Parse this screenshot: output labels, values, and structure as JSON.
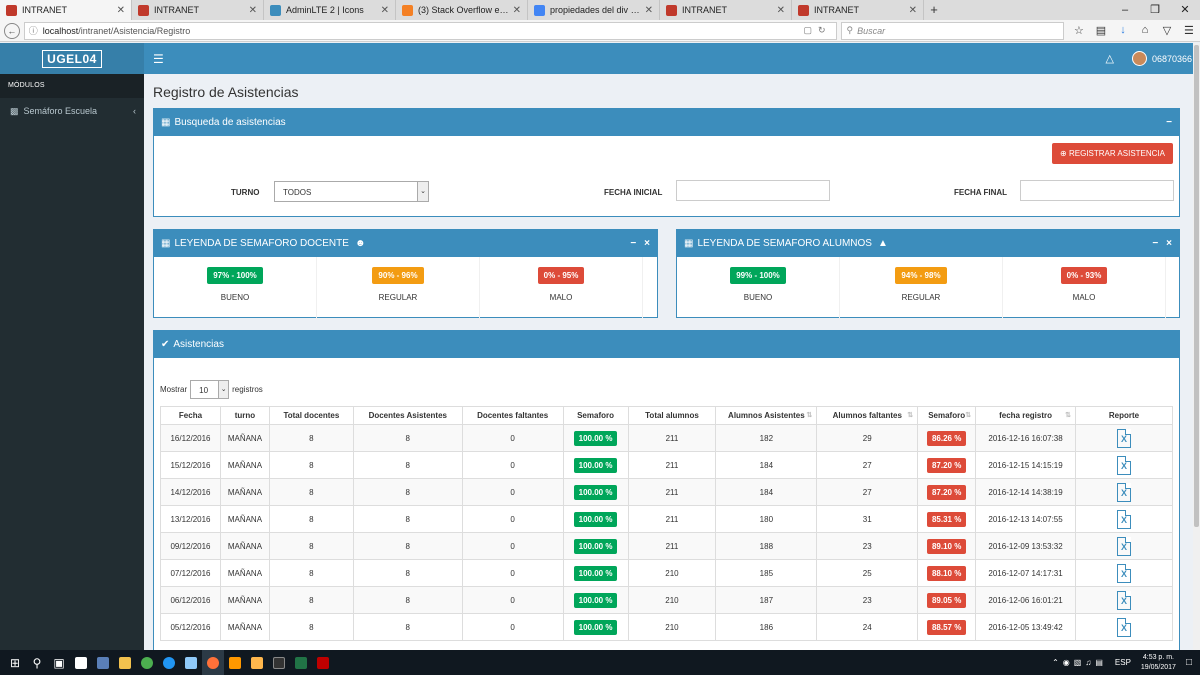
{
  "browser": {
    "tabs": [
      {
        "label": "INTRANET",
        "color": "#c0392b"
      },
      {
        "label": "INTRANET",
        "color": "#c0392b"
      },
      {
        "label": "AdminLTE 2 | Icons",
        "color": "#3c8dbc"
      },
      {
        "label": "(3) Stack Overflow en españ",
        "color": "#f48024"
      },
      {
        "label": "propiedades del div - Buscar",
        "color": "#4285f4"
      },
      {
        "label": "INTRANET",
        "color": "#c0392b"
      },
      {
        "label": "INTRANET",
        "color": "#c0392b"
      }
    ],
    "url_host": "localhost",
    "url_path": "/intranet/Asistencia/Registro",
    "search_placeholder": "Buscar"
  },
  "app": {
    "logo": "UGEL04",
    "username": "06870366",
    "page_title": "Registro de Asistencias"
  },
  "sidebar": {
    "header": "MÓDULOS",
    "items": [
      {
        "label": "Semáforo Escuela"
      }
    ]
  },
  "search_box": {
    "title": "Busqueda de asistencias",
    "register_button": "REGISTRAR ASISTENCIA",
    "turno_label": "TURNO",
    "turno_value": "TODOS",
    "fecha_inicial_label": "FECHA INICIAL",
    "fecha_final_label": "FECHA FINAL"
  },
  "legend_docente": {
    "title": "LEYENDA DE SEMAFORO DOCENTE",
    "items": [
      {
        "range": "97% - 100%",
        "label": "BUENO",
        "color": "#00a65a"
      },
      {
        "range": "90% - 96%",
        "label": "REGULAR",
        "color": "#f39c12"
      },
      {
        "range": "0% - 95%",
        "label": "MALO",
        "color": "#dd4b39"
      }
    ]
  },
  "legend_alumnos": {
    "title": "LEYENDA DE SEMAFORO ALUMNOS",
    "items": [
      {
        "range": "99% - 100%",
        "label": "BUENO",
        "color": "#00a65a"
      },
      {
        "range": "94% - 98%",
        "label": "REGULAR",
        "color": "#f39c12"
      },
      {
        "range": "0% - 93%",
        "label": "MALO",
        "color": "#dd4b39"
      }
    ]
  },
  "asistencias": {
    "title": "Asistencias",
    "show_label": "Mostrar",
    "page_size": "10",
    "records_label": "registros",
    "columns": [
      "Fecha",
      "turno",
      "Total docentes",
      "Docentes Asistentes",
      "Docentes faltantes",
      "Semaforo",
      "Total alumnos",
      "Alumnos Asistentes",
      "Alumnos faltantes",
      "Semaforo",
      "fecha registro",
      "Reporte"
    ],
    "rows": [
      {
        "fecha": "16/12/2016",
        "turno": "MAÑANA",
        "total_doc": "8",
        "doc_asis": "8",
        "doc_falt": "0",
        "sem_doc": "100.00 %",
        "total_alu": "211",
        "alu_asis": "182",
        "alu_falt": "29",
        "sem_alu": "86.26 %",
        "registro": "2016-12-16 16:07:38"
      },
      {
        "fecha": "15/12/2016",
        "turno": "MAÑANA",
        "total_doc": "8",
        "doc_asis": "8",
        "doc_falt": "0",
        "sem_doc": "100.00 %",
        "total_alu": "211",
        "alu_asis": "184",
        "alu_falt": "27",
        "sem_alu": "87.20 %",
        "registro": "2016-12-15 14:15:19"
      },
      {
        "fecha": "14/12/2016",
        "turno": "MAÑANA",
        "total_doc": "8",
        "doc_asis": "8",
        "doc_falt": "0",
        "sem_doc": "100.00 %",
        "total_alu": "211",
        "alu_asis": "184",
        "alu_falt": "27",
        "sem_alu": "87.20 %",
        "registro": "2016-12-14 14:38:19"
      },
      {
        "fecha": "13/12/2016",
        "turno": "MAÑANA",
        "total_doc": "8",
        "doc_asis": "8",
        "doc_falt": "0",
        "sem_doc": "100.00 %",
        "total_alu": "211",
        "alu_asis": "180",
        "alu_falt": "31",
        "sem_alu": "85.31 %",
        "registro": "2016-12-13 14:07:55"
      },
      {
        "fecha": "09/12/2016",
        "turno": "MAÑANA",
        "total_doc": "8",
        "doc_asis": "8",
        "doc_falt": "0",
        "sem_doc": "100.00 %",
        "total_alu": "211",
        "alu_asis": "188",
        "alu_falt": "23",
        "sem_alu": "89.10 %",
        "registro": "2016-12-09 13:53:32"
      },
      {
        "fecha": "07/12/2016",
        "turno": "MAÑANA",
        "total_doc": "8",
        "doc_asis": "8",
        "doc_falt": "0",
        "sem_doc": "100.00 %",
        "total_alu": "210",
        "alu_asis": "185",
        "alu_falt": "25",
        "sem_alu": "88.10 %",
        "registro": "2016-12-07 14:17:31"
      },
      {
        "fecha": "06/12/2016",
        "turno": "MAÑANA",
        "total_doc": "8",
        "doc_asis": "8",
        "doc_falt": "0",
        "sem_doc": "100.00 %",
        "total_alu": "210",
        "alu_asis": "187",
        "alu_falt": "23",
        "sem_alu": "89.05 %",
        "registro": "2016-12-06 16:01:21"
      },
      {
        "fecha": "05/12/2016",
        "turno": "MAÑANA",
        "total_doc": "8",
        "doc_asis": "8",
        "doc_falt": "0",
        "sem_doc": "100.00 %",
        "total_alu": "210",
        "alu_asis": "186",
        "alu_falt": "24",
        "sem_alu": "88.57 %",
        "registro": "2016-12-05 13:49:42"
      }
    ]
  },
  "taskbar": {
    "language": "ESP",
    "time": "4:53 p. m.",
    "date": "19/05/2017"
  }
}
